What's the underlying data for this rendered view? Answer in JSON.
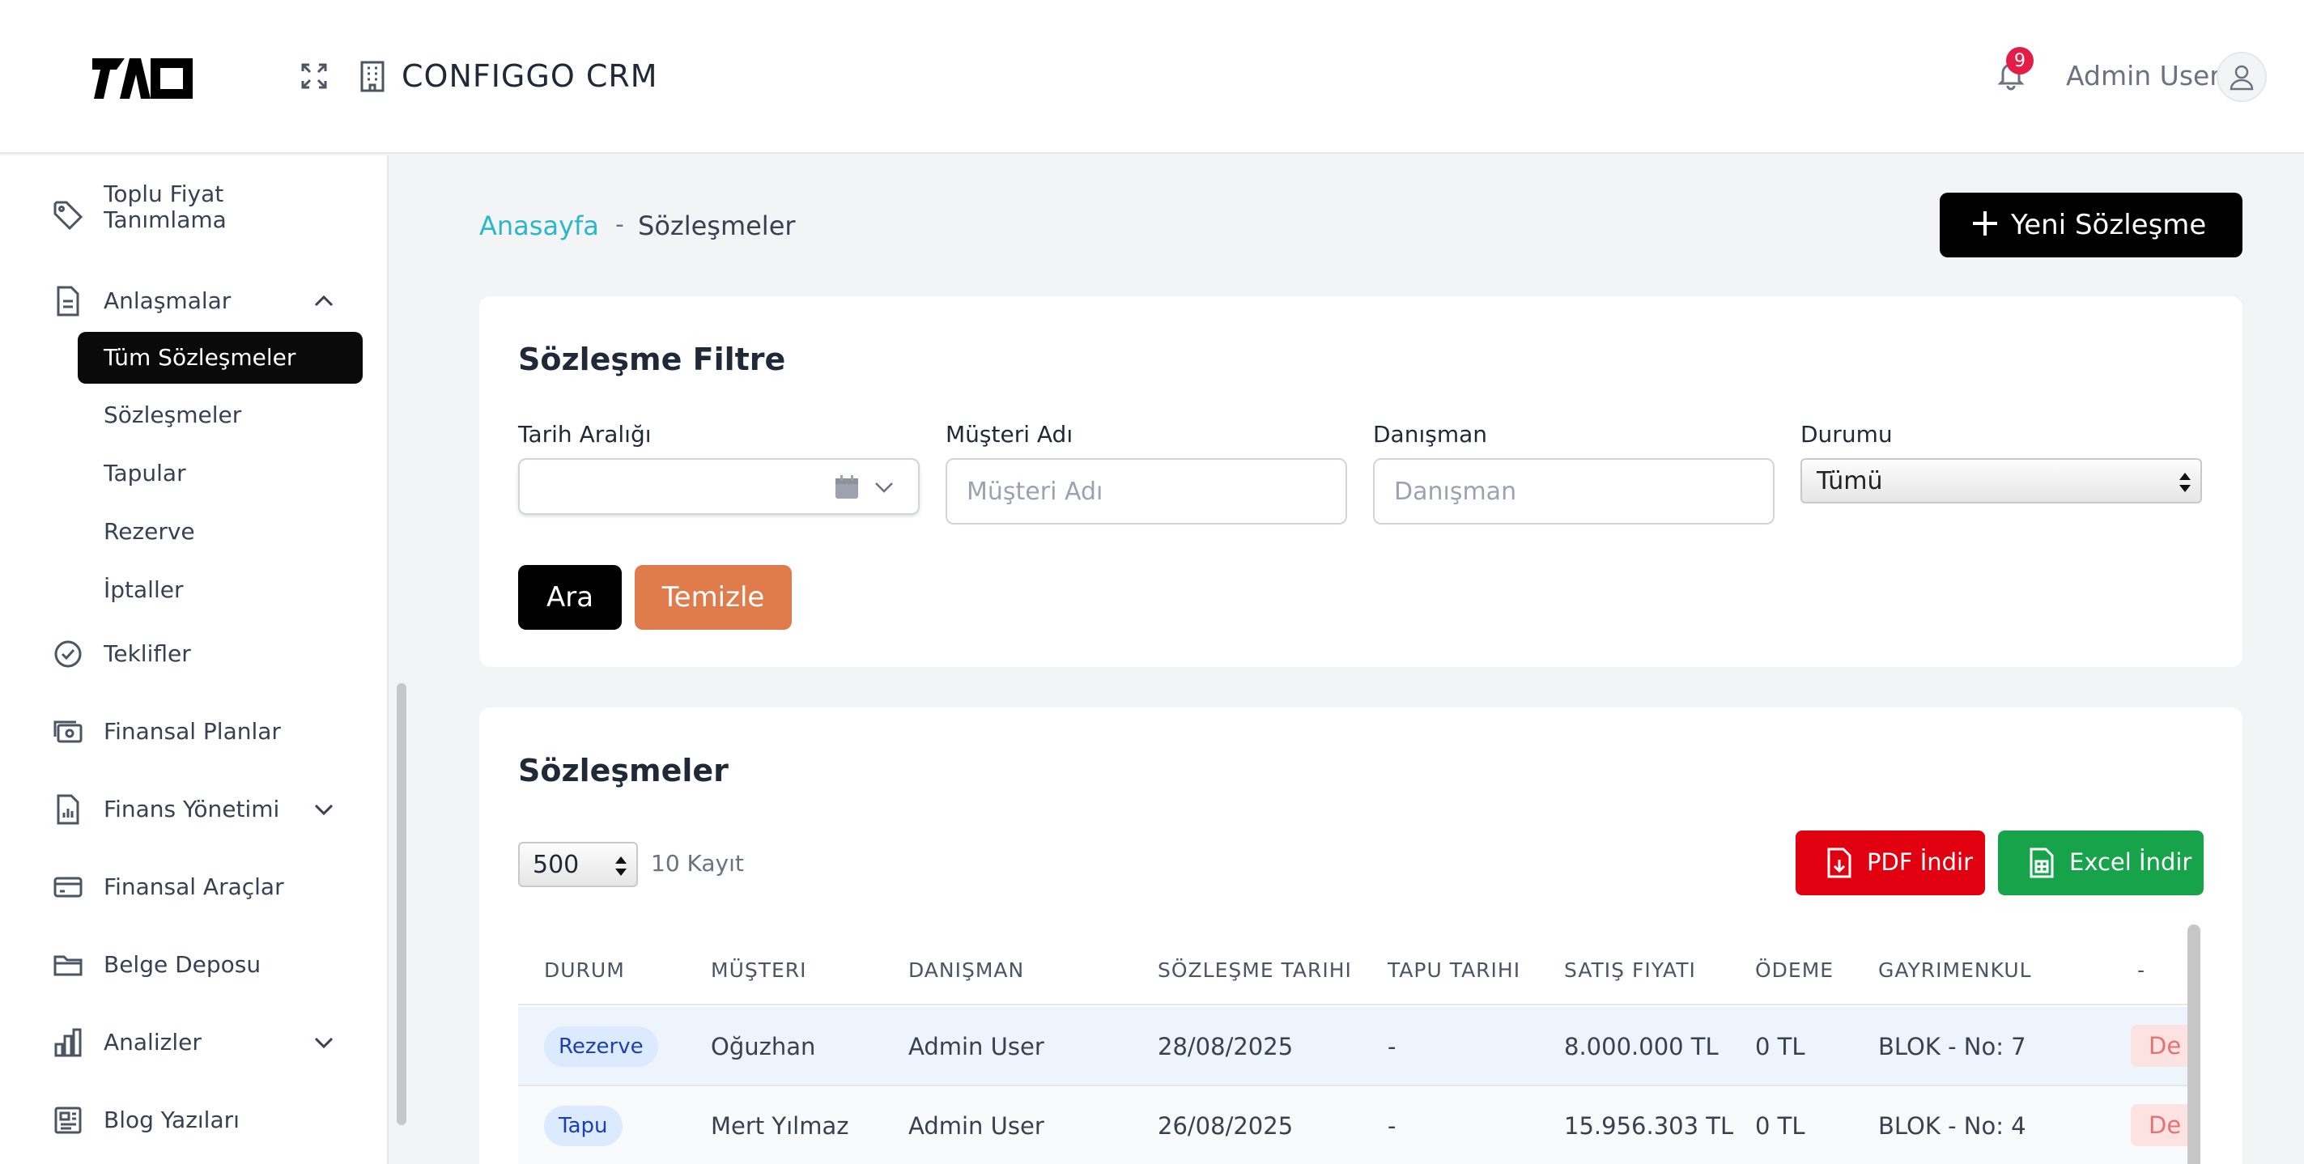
{
  "header": {
    "app_title": "CONFIGGO  CRM",
    "notification_count": "9",
    "user_name": "Admin User"
  },
  "sidebar": {
    "items": [
      {
        "label": "Toplu Fiyat Tanımlama",
        "icon": "tag-icon"
      },
      {
        "label": "Anlaşmalar",
        "icon": "document-icon",
        "expanded": true
      },
      {
        "label": "Teklifler",
        "icon": "check-circle-icon"
      },
      {
        "label": "Finansal Planlar",
        "icon": "money-icon"
      },
      {
        "label": "Finans Yönetimi",
        "icon": "report-icon",
        "expanded": false
      },
      {
        "label": "Finansal Araçlar",
        "icon": "credit-card-icon"
      },
      {
        "label": "Belge Deposu",
        "icon": "folder-icon"
      },
      {
        "label": "Analizler",
        "icon": "bar-chart-icon",
        "expanded": false
      },
      {
        "label": "Blog Yazıları",
        "icon": "newspaper-icon"
      }
    ],
    "sub_items": [
      "Tüm Sözleşmeler",
      "Sözleşmeler",
      "Tapular",
      "Rezerve",
      "İptaller"
    ],
    "active_sub": "Tüm Sözleşmeler"
  },
  "breadcrumb": {
    "home": "Anasayfa",
    "separator": "-",
    "current": "Sözleşmeler"
  },
  "new_button": "Yeni Sözleşme",
  "filter": {
    "title": "Sözleşme Filtre",
    "date_label": "Tarih Aralığı",
    "customer_label": "Müşteri Adı",
    "customer_placeholder": "Müşteri Adı",
    "advisor_label": "Danışman",
    "advisor_placeholder": "Danışman",
    "status_label": "Durumu",
    "status_value": "Tümü",
    "search_button": "Ara",
    "clear_button": "Temizle"
  },
  "contracts": {
    "title": "Sözleşmeler",
    "page_size": "500",
    "record_count": "10 Kayıt",
    "pdf_button": "PDF İndir",
    "excel_button": "Excel İndir",
    "columns": [
      "DURUM",
      "MÜŞTERI",
      "DANIŞMAN",
      "SÖZLEŞME TARIHI",
      "TAPU TARIHI",
      "SATIŞ FIYATI",
      "ÖDEME",
      "GAYRIMENKUL",
      "-"
    ],
    "rows": [
      {
        "status": "Rezerve",
        "customer": "Oğuzhan",
        "advisor": "Admin User",
        "contract_date": "28/08/2025",
        "deed_date": "-",
        "price": "8.000.000 TL",
        "payment": "0 TL",
        "property": "BLOK - No: 7",
        "action": "De"
      },
      {
        "status": "Tapu",
        "customer": "Mert Yılmaz",
        "advisor": "Admin User",
        "contract_date": "26/08/2025",
        "deed_date": "-",
        "price": "15.956.303 TL",
        "payment": "0 TL",
        "property": "BLOK - No: 4",
        "action": "De"
      }
    ]
  },
  "colors": {
    "accent": "#2ab7c9",
    "primary": "#000000",
    "clear": "#e07b4c",
    "pdf": "#e0000f",
    "excel": "#16a34a"
  }
}
